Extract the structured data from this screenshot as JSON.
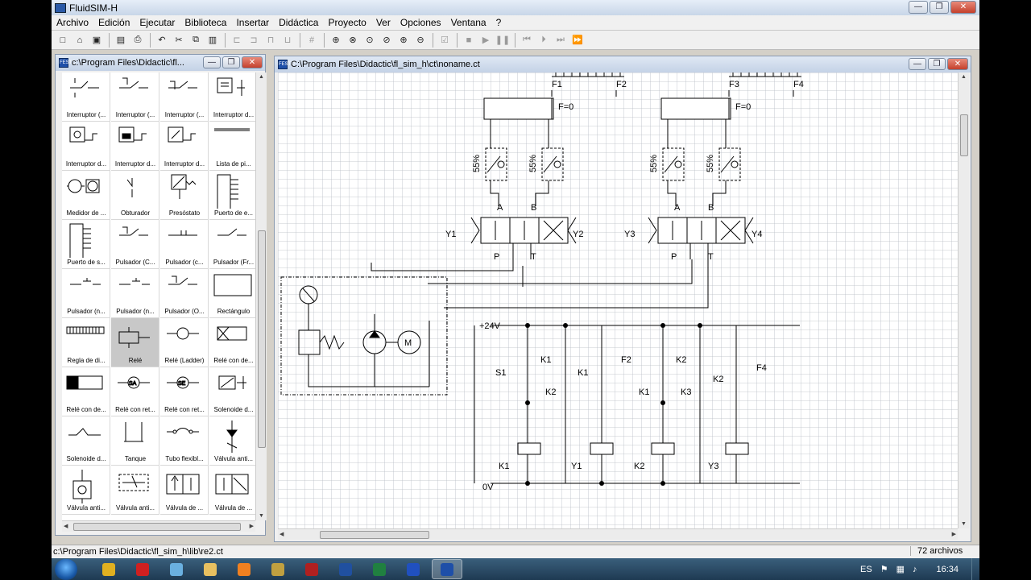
{
  "app": {
    "title": "FluidSIM-H"
  },
  "menu": [
    "Archivo",
    "Edición",
    "Ejecutar",
    "Biblioteca",
    "Insertar",
    "Didáctica",
    "Proyecto",
    "Ver",
    "Opciones",
    "Ventana",
    "?"
  ],
  "toolbar": {
    "buttons": [
      {
        "name": "new-icon",
        "glyph": "□"
      },
      {
        "name": "open-icon",
        "glyph": "⌂"
      },
      {
        "name": "save-icon",
        "glyph": "▣"
      },
      {
        "sep": true
      },
      {
        "name": "open-lib-icon",
        "glyph": "▤"
      },
      {
        "name": "print-icon",
        "glyph": "⎙"
      },
      {
        "sep": true
      },
      {
        "name": "undo-icon",
        "glyph": "↶"
      },
      {
        "name": "cut-icon",
        "glyph": "✂"
      },
      {
        "name": "copy-icon",
        "glyph": "⧉"
      },
      {
        "name": "paste-icon",
        "glyph": "▥"
      },
      {
        "sep": true
      },
      {
        "name": "align-left-icon",
        "glyph": "⊏",
        "disabled": true
      },
      {
        "name": "align-center-icon",
        "glyph": "⊐",
        "disabled": true
      },
      {
        "name": "align-top-icon",
        "glyph": "⊓",
        "disabled": true
      },
      {
        "name": "align-bottom-icon",
        "glyph": "⊔",
        "disabled": true
      },
      {
        "sep": true
      },
      {
        "name": "grid-icon",
        "glyph": "#",
        "disabled": true
      },
      {
        "sep": true
      },
      {
        "name": "zoom-all-icon",
        "glyph": "⊕"
      },
      {
        "name": "zoom-fit-icon",
        "glyph": "⊗"
      },
      {
        "name": "zoom-window-icon",
        "glyph": "⊙"
      },
      {
        "name": "zoom-prev-icon",
        "glyph": "⊘"
      },
      {
        "name": "zoom-in-icon",
        "glyph": "⊕"
      },
      {
        "name": "zoom-out-icon",
        "glyph": "⊖"
      },
      {
        "sep": true
      },
      {
        "name": "check-icon",
        "glyph": "☑",
        "disabled": true
      },
      {
        "sep": true
      },
      {
        "name": "stop-icon",
        "glyph": "■",
        "disabled": true
      },
      {
        "name": "play-icon",
        "glyph": "▶",
        "disabled": true
      },
      {
        "name": "pause-icon",
        "glyph": "❚❚",
        "disabled": true
      },
      {
        "sep": true
      },
      {
        "name": "reset-icon",
        "glyph": "⏮",
        "disabled": true
      },
      {
        "name": "step-icon",
        "glyph": "⏵",
        "disabled": true
      },
      {
        "name": "step-next-icon",
        "glyph": "⏭",
        "disabled": true
      },
      {
        "name": "forward-icon",
        "glyph": "⏩",
        "disabled": true
      }
    ]
  },
  "library_window": {
    "title": "c:\\Program Files\\Didactic\\fl...",
    "items": [
      "Interruptor (...",
      "Interruptor (...",
      "Interruptor (...",
      "Interruptor d...",
      "Interruptor d...",
      "Interruptor d...",
      "Interruptor d...",
      "Lista de pi...",
      "Medidor de ...",
      "Obturador",
      "Presóstato",
      "Puerto de e...",
      "Puerto de s...",
      "Pulsador (C...",
      "Pulsador (c...",
      "Pulsador (Fr...",
      "Pulsador (n...",
      "Pulsador (n...",
      "Pulsador (O...",
      "Rectángulo",
      "Regla de di...",
      "Relé",
      "Relé (Ladder)",
      "Relé con de...",
      "Relé con de...",
      "Relé con ret...",
      "Relé con ret...",
      "Solenoide d...",
      "Solenoide d...",
      "Tanque",
      "Tubo flexibl...",
      "Válvula anti...",
      "Válvula anti...",
      "Válvula anti...",
      "Válvula de ...",
      "Válvula de ..."
    ],
    "selected_index": 21
  },
  "circuit_window": {
    "title": "C:\\Program Files\\Didactic\\fl_sim_h\\ct\\noname.ct",
    "hydraulic": {
      "rulers": [
        "F1",
        "F2",
        "F3",
        "F4"
      ],
      "force": "F=0",
      "throttle": "55%",
      "ports": [
        "A",
        "B",
        "P",
        "T"
      ],
      "solenoids": [
        "Y1",
        "Y2",
        "Y3",
        "Y4"
      ],
      "motor": "M"
    },
    "electrical": {
      "supply_plus": "+24V",
      "supply_minus": "0V",
      "contacts": [
        "S1",
        "K1",
        "K2",
        "K1",
        "F2",
        "K2",
        "K1",
        "K3",
        "K2",
        "F4"
      ],
      "coils": [
        "K1",
        "Y1",
        "K2",
        "Y3"
      ]
    }
  },
  "statusbar": {
    "path": "c:\\Program Files\\Didactic\\fl_sim_h\\lib\\re2.ct",
    "count": "72 archivos"
  },
  "taskbar": {
    "apps": [
      {
        "name": "chrome-icon",
        "color": "#e0b020"
      },
      {
        "name": "opera-icon",
        "color": "#d02020"
      },
      {
        "name": "network-icon",
        "color": "#6ab0e0"
      },
      {
        "name": "explorer-icon",
        "color": "#e8c060"
      },
      {
        "name": "media-player-icon",
        "color": "#f08020"
      },
      {
        "name": "app-icon",
        "color": "#c0a040"
      },
      {
        "name": "app-red-icon",
        "color": "#b02020"
      },
      {
        "name": "festo-icon",
        "color": "#2050a0"
      },
      {
        "name": "excel-icon",
        "color": "#208040"
      },
      {
        "name": "word-icon",
        "color": "#2050c0"
      },
      {
        "name": "fluidsim-icon",
        "color": "#1e4fa8",
        "active": true
      }
    ],
    "language": "ES",
    "time": "16:34"
  },
  "colors": {
    "canvas_bg": "#ffffff",
    "grid": "#b8bcc4",
    "accent": "#1e4fa8"
  }
}
